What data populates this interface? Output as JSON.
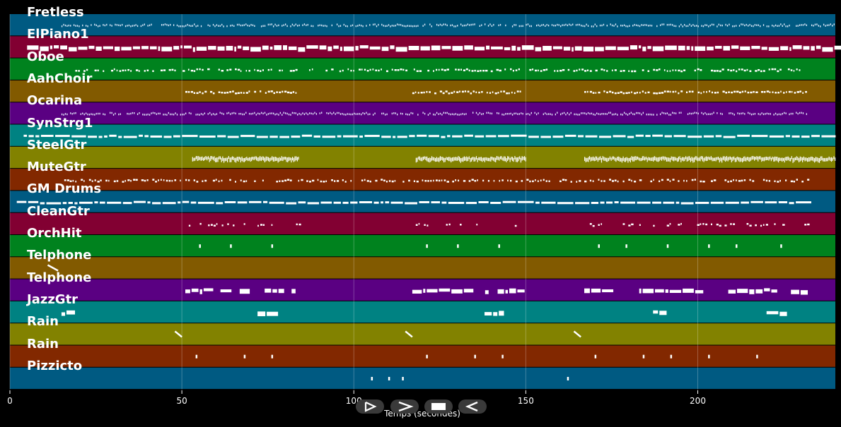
{
  "tracks": [
    {
      "name": "Fretless",
      "color": "#005a82"
    },
    {
      "name": "ElPiano1",
      "color": "#820032"
    },
    {
      "name": "Oboe",
      "color": "#00821e"
    },
    {
      "name": "AahChoir",
      "color": "#825a00"
    },
    {
      "name": "Ocarina",
      "color": "#5a0082"
    },
    {
      "name": "SynStrg1",
      "color": "#008282"
    },
    {
      "name": "SteelGtr",
      "color": "#828200"
    },
    {
      "name": "MuteGtr",
      "color": "#822800"
    },
    {
      "name": "GM Drums",
      "color": "#005a82"
    },
    {
      "name": "CleanGtr",
      "color": "#820032"
    },
    {
      "name": "OrchHit",
      "color": "#00821e"
    },
    {
      "name": "Telphone",
      "color": "#825a00"
    },
    {
      "name": "Telphone",
      "color": "#5a0082"
    },
    {
      "name": "JazzGtr",
      "color": "#008282"
    },
    {
      "name": "Rain",
      "color": "#828200"
    },
    {
      "name": "Rain",
      "color": "#822800"
    },
    {
      "name": "Pizzicto",
      "color": "#005a82"
    }
  ],
  "axis": {
    "xlabel": "Temps (secondes)",
    "xlim": [
      0,
      240
    ],
    "ticks": [
      "0",
      "50",
      "100",
      "150",
      "200"
    ],
    "tick_values": [
      0,
      50,
      100,
      150,
      200
    ]
  },
  "controls": [
    {
      "name": "play-button",
      "icon": "play-icon"
    },
    {
      "name": "fast-forward-button",
      "icon": "fast-forward-icon"
    },
    {
      "name": "stop-button",
      "icon": "stop-icon"
    },
    {
      "name": "rewind-button",
      "icon": "rewind-icon"
    }
  ],
  "colors": {
    "background": "#000000",
    "note": "#ffffff",
    "gridline": "#ffffff"
  }
}
